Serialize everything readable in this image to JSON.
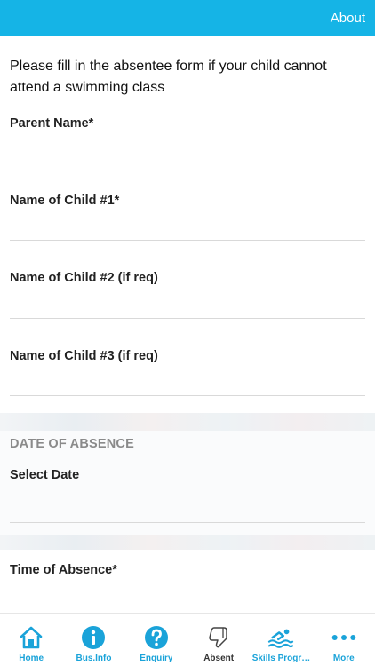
{
  "header": {
    "about_label": "About"
  },
  "intro_text": "Please fill in the absentee form if your child cannot attend a swimming class",
  "fields": {
    "parent_name": {
      "label": "Parent Name*",
      "value": ""
    },
    "child1": {
      "label": "Name of Child #1*",
      "value": ""
    },
    "child2": {
      "label": "Name of Child #2 (if req)",
      "value": ""
    },
    "child3": {
      "label": "Name of Child #3 (if req)",
      "value": ""
    },
    "select_date": {
      "label": "Select Date",
      "value": ""
    },
    "time_of_absence": {
      "label": "Time of Absence*",
      "value": ""
    }
  },
  "section": {
    "date_of_absence": "DATE OF ABSENCE"
  },
  "tabs": [
    {
      "label": "Home",
      "icon": "home-icon"
    },
    {
      "label": "Bus.Info",
      "icon": "info-icon"
    },
    {
      "label": "Enquiry",
      "icon": "question-icon"
    },
    {
      "label": "Absent",
      "icon": "thumbs-down-icon"
    },
    {
      "label": "Skills Progr…",
      "icon": "swimmer-icon"
    },
    {
      "label": "More",
      "icon": "more-icon"
    }
  ],
  "colors": {
    "accent": "#15b4e6",
    "tab_label": "#1aa3d9",
    "active_tab_label": "#333333"
  },
  "active_tab": "Absent"
}
